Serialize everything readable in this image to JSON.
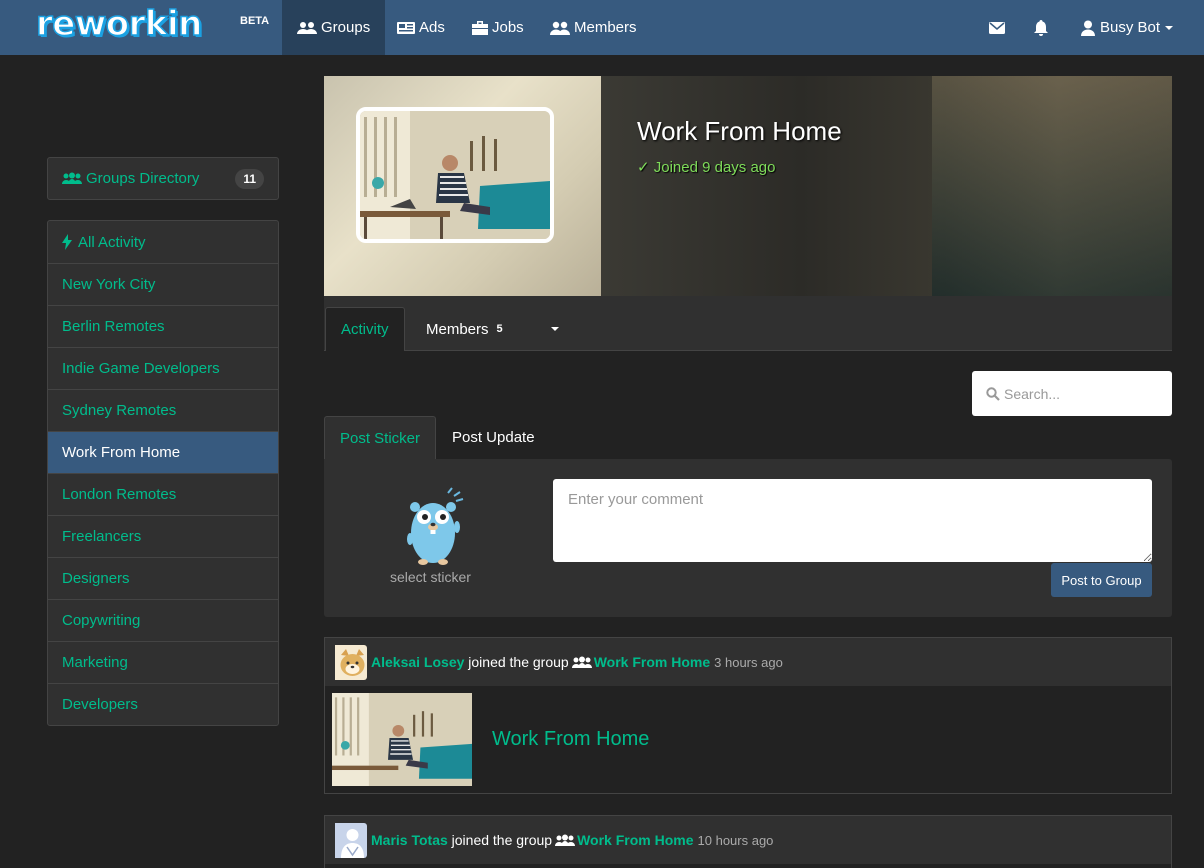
{
  "navbar": {
    "brand": "reworkin",
    "beta": "BETA",
    "items": [
      {
        "label": "Groups",
        "icon": "users-icon"
      },
      {
        "label": "Ads",
        "icon": "newspaper-icon"
      },
      {
        "label": "Jobs",
        "icon": "briefcase-icon"
      },
      {
        "label": "Members",
        "icon": "user-friends-icon"
      }
    ],
    "user": "Busy Bot"
  },
  "sidebar": {
    "directory": {
      "label": "Groups Directory",
      "count": "11"
    },
    "items": [
      {
        "label": "All Activity"
      },
      {
        "label": "New York City"
      },
      {
        "label": "Berlin Remotes"
      },
      {
        "label": "Indie Game Developers"
      },
      {
        "label": "Sydney Remotes"
      },
      {
        "label": "Work From Home",
        "active": true
      },
      {
        "label": "London Remotes"
      },
      {
        "label": "Freelancers"
      },
      {
        "label": "Designers"
      },
      {
        "label": "Copywriting"
      },
      {
        "label": "Marketing"
      },
      {
        "label": "Developers"
      }
    ]
  },
  "group": {
    "title": "Work From Home",
    "joined": "✓ Joined 9 days ago"
  },
  "tabs": {
    "activity": "Activity",
    "members": "Members",
    "members_count": "5"
  },
  "search": {
    "placeholder": "Search..."
  },
  "post": {
    "tab_sticker": "Post Sticker",
    "tab_update": "Post Update",
    "sticker_label": "select sticker",
    "comment_placeholder": "Enter your comment",
    "submit": "Post to Group"
  },
  "activity": [
    {
      "user": "Aleksai Losey",
      "action": "joined the group",
      "group": "Work From Home",
      "ago": "3 hours ago",
      "title": "Work From Home"
    },
    {
      "user": "Maris Totas",
      "action": "joined the group",
      "group": "Work From Home",
      "ago": "10 hours ago"
    }
  ],
  "colors": {
    "navbar": "#375a7f",
    "accent": "#00bc8c",
    "background": "#222222",
    "panel": "#303030"
  }
}
